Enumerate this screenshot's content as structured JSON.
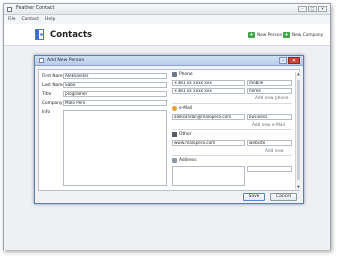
{
  "window": {
    "title": "Feather Contact",
    "controls": [
      "–",
      "□",
      "✕"
    ]
  },
  "menu": [
    "File",
    "Contact",
    "Help"
  ],
  "header": {
    "title": "Contacts",
    "new_person": "New Person",
    "new_company": "New Company"
  },
  "dialog": {
    "title": "Add New Person",
    "close": "✕",
    "minimize": "–",
    "labels": {
      "first_name": "First Name",
      "last_name": "Last Name",
      "title": "Title",
      "company": "Company",
      "info": "Info"
    },
    "values": {
      "first_name": "Aleksandar",
      "last_name": "Sabo",
      "title": "programer",
      "company": "Malo Pero"
    },
    "phone": {
      "heading": "Phone",
      "rows": [
        {
          "number": "+381 xx xxxx xxx",
          "type": "mobile"
        },
        {
          "number": "+381 xx xxxx xxx",
          "type": "home"
        }
      ],
      "add": "Add new phone"
    },
    "email": {
      "heading": "e-Mail",
      "rows": [
        {
          "address": "aleksandar@malopero.com",
          "type": "business"
        }
      ],
      "add": "Add new e-Mail"
    },
    "other": {
      "heading": "Other",
      "rows": [
        {
          "value": "www.malopero.com",
          "type": "website"
        }
      ],
      "add": "Add new"
    },
    "address": {
      "heading": "Address"
    },
    "buttons": {
      "save": "Save",
      "cancel": "Cancel"
    },
    "scroll": {
      "up": "▲",
      "down": "▼"
    }
  }
}
